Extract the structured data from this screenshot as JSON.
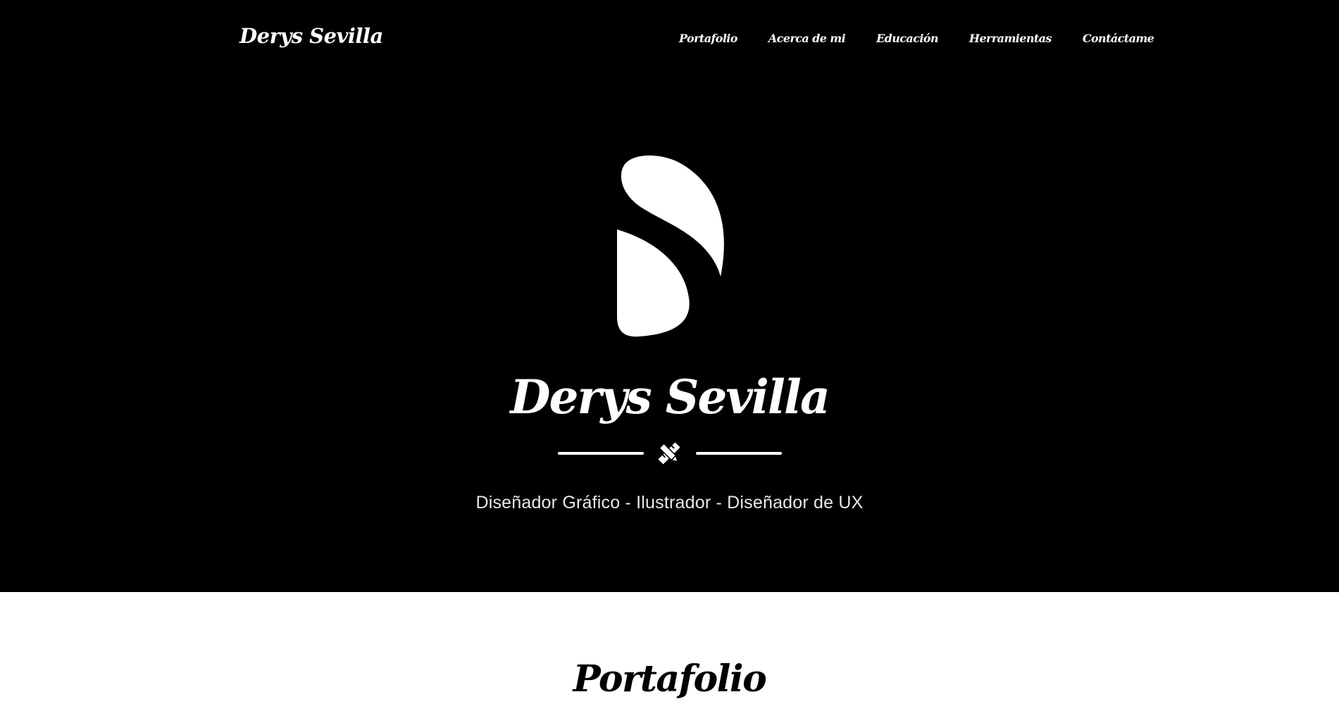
{
  "header": {
    "brand": "Derys Sevilla",
    "nav": [
      {
        "label": "Portafolio"
      },
      {
        "label": "Acerca de mi"
      },
      {
        "label": "Educación"
      },
      {
        "label": "Herramientas"
      },
      {
        "label": "Contáctame"
      }
    ]
  },
  "hero": {
    "logo_icon": "s-monogram-logo",
    "title": "Derys Sevilla",
    "divider_icon": "pencil-ruler-icon",
    "subtitle": "Diseñador Gráfico - Ilustrador - Diseñador de UX"
  },
  "portfolio": {
    "title": "Portafolio"
  },
  "colors": {
    "hero_background": "#000000",
    "hero_text": "#ffffff",
    "page_background": "#ffffff",
    "section_text": "#000000"
  }
}
